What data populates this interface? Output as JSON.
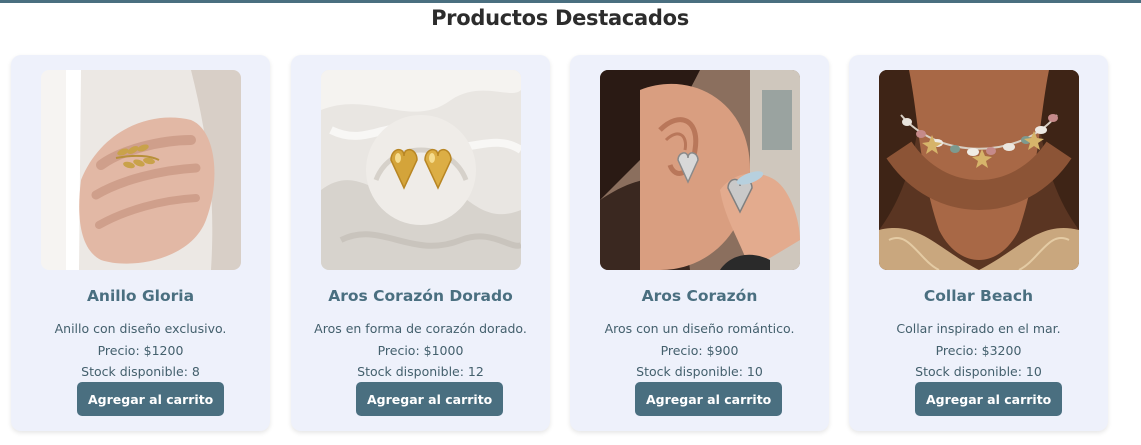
{
  "section": {
    "title": "Productos Destacados"
  },
  "colors": {
    "accent": "#4a6f80",
    "card_bg": "#eef1fb"
  },
  "products": [
    {
      "name": "Anillo Gloria",
      "description": "Anillo con diseño exclusivo.",
      "price": "Precio: $1200",
      "stock": "Stock disponible: 8",
      "button": "Agregar al carrito",
      "image": "ring-on-hand"
    },
    {
      "name": "Aros Corazón Dorado",
      "description": "Aros en forma de corazón dorado.",
      "price": "Precio: $1000",
      "stock": "Stock disponible: 12",
      "button": "Agregar al carrito",
      "image": "gold-heart-earrings-on-silk"
    },
    {
      "name": "Aros Corazón",
      "description": "Aros con un diseño romántico.",
      "price": "Precio: $900",
      "stock": "Stock disponible: 10",
      "button": "Agregar al carrito",
      "image": "silver-heart-earring-on-ear"
    },
    {
      "name": "Collar Beach",
      "description": "Collar inspirado en el mar.",
      "price": "Precio: $3200",
      "stock": "Stock disponible: 10",
      "button": "Agregar al carrito",
      "image": "beach-necklace-on-neck"
    }
  ]
}
